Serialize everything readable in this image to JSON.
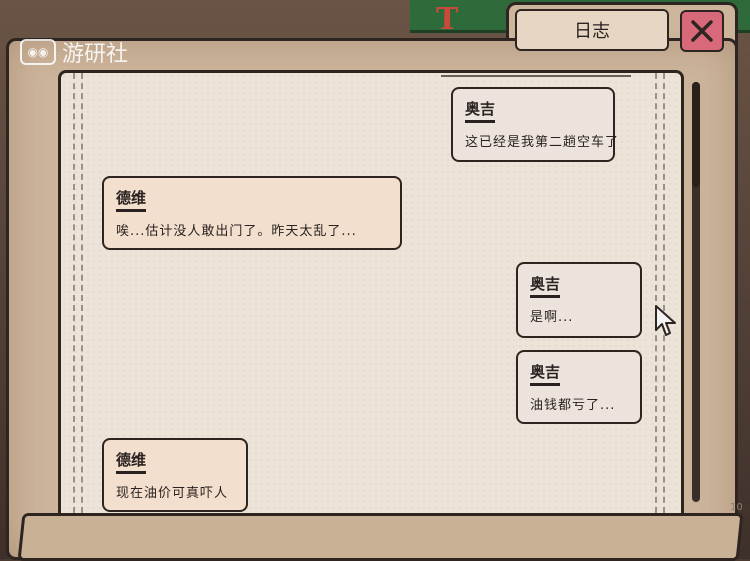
{
  "watermark": {
    "text": "游研社"
  },
  "scene": {
    "sign_letters": "T I N"
  },
  "window": {
    "title": "日志"
  },
  "messages": [
    {
      "side": "right",
      "speaker": "奥吉",
      "text": "这已经是我第二趟空车了"
    },
    {
      "side": "left",
      "speaker": "德维",
      "text": "唉...估计没人敢出门了。昨天太乱了..."
    },
    {
      "side": "right",
      "speaker": "奥吉",
      "text": "是啊..."
    },
    {
      "side": "right",
      "speaker": "奥吉",
      "text": "油钱都亏了..."
    },
    {
      "side": "left",
      "speaker": "德维",
      "text": "现在油价可真吓人"
    }
  ],
  "colors": {
    "folder": "#cdb59c",
    "paper": "#ece4d8",
    "close_button": "#d8697a",
    "left_bubble": "#f2dfcd",
    "right_bubble": "#ece4dc"
  },
  "icons": {
    "close": "close-x-icon",
    "cursor": "mouse-pointer-icon"
  },
  "footer": {
    "page_marker": "10"
  }
}
